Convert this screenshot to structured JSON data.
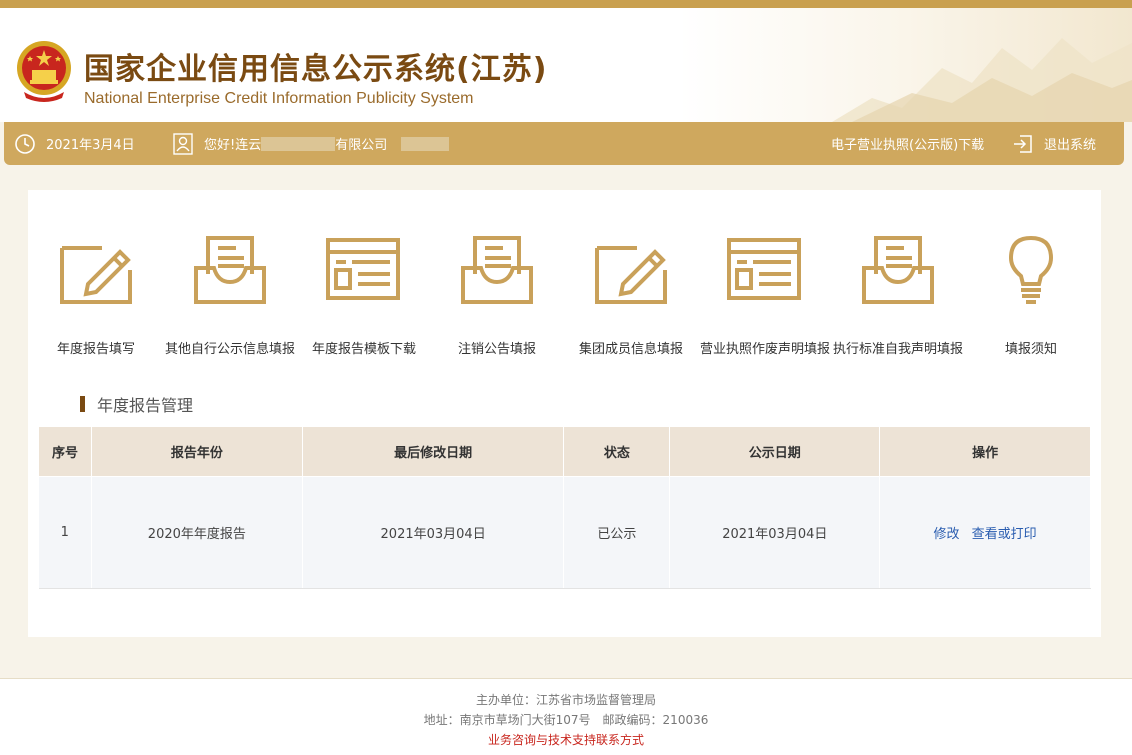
{
  "header": {
    "title": "国家企业信用信息公示系统(江苏)",
    "subtitle": "National Enterprise Credit Information Publicity System",
    "emblem_icon": "national-emblem-icon"
  },
  "navbar": {
    "date": "2021年3月4日",
    "greeting_prefix": "您好!连云",
    "greeting_suffix": "有限公司",
    "download_label": "电子营业执照(公示版)下载",
    "logout_label": "退出系统",
    "icons": {
      "date": "clock-icon",
      "user": "user-icon",
      "logout": "logout-icon"
    }
  },
  "tools": [
    {
      "label": "年度报告填写",
      "icon": "edit-form-icon"
    },
    {
      "label": "其他自行公示信息填报",
      "icon": "inbox-document-icon"
    },
    {
      "label": "年度报告模板下载",
      "icon": "template-window-icon"
    },
    {
      "label": "注销公告填报",
      "icon": "inbox-document-icon"
    },
    {
      "label": "集团成员信息填报",
      "icon": "edit-form-icon"
    },
    {
      "label": "营业执照作废声明填报",
      "icon": "template-window-icon"
    },
    {
      "label": "执行标准自我声明填报",
      "icon": "inbox-document-icon"
    },
    {
      "label": "填报须知",
      "icon": "lightbulb-icon"
    }
  ],
  "section": {
    "title": "年度报告管理"
  },
  "table": {
    "columns": [
      "序号",
      "报告年份",
      "最后修改日期",
      "状态",
      "公示日期",
      "操作"
    ],
    "rows": [
      {
        "index": "1",
        "year": "2020年年度报告",
        "modified": "2021年03月04日",
        "status": "已公示",
        "published": "2021年03月04日",
        "actions": [
          "修改",
          "查看或打印"
        ]
      }
    ]
  },
  "footer": {
    "host": "主办单位：江苏省市场监督管理局",
    "address": "地址：南京市草场门大街107号　邮政编码：210036",
    "support_link": "业务咨询与技术支持联系方式"
  },
  "colors": {
    "accent": "#cfa85e",
    "brand": "#7a4a12",
    "link": "#2a5db0",
    "footer_link": "#c8261e",
    "header_bg": "#ede3d6"
  }
}
